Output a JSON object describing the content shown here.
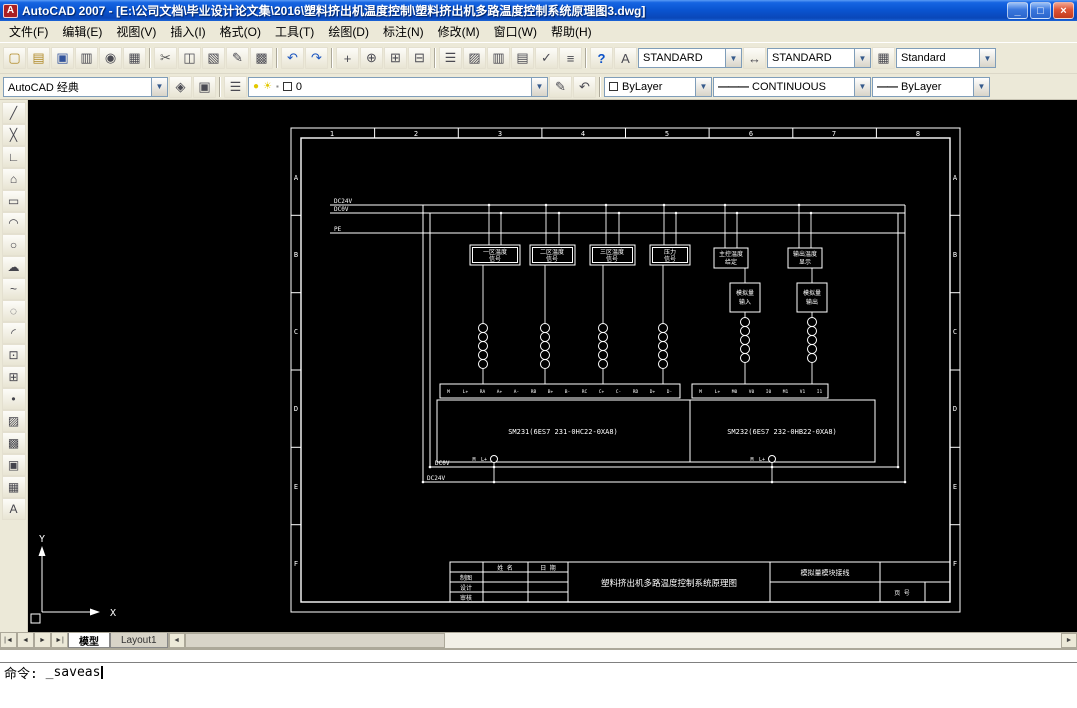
{
  "window": {
    "title": "AutoCAD 2007 - [E:\\公司文档\\毕业设计论文集\\2016\\塑料挤出机温度控制\\塑料挤出机多路温度控制系统原理图3.dwg]",
    "app_initial": "A",
    "minimize": "_",
    "maximize": "□",
    "close": "×"
  },
  "menu": {
    "items": [
      {
        "name": "menu-file",
        "label": "文件(F)"
      },
      {
        "name": "menu-edit",
        "label": "编辑(E)"
      },
      {
        "name": "menu-view",
        "label": "视图(V)"
      },
      {
        "name": "menu-insert",
        "label": "插入(I)"
      },
      {
        "name": "menu-format",
        "label": "格式(O)"
      },
      {
        "name": "menu-tools",
        "label": "工具(T)"
      },
      {
        "name": "menu-draw",
        "label": "绘图(D)"
      },
      {
        "name": "menu-dimension",
        "label": "标注(N)"
      },
      {
        "name": "menu-modify",
        "label": "修改(M)"
      },
      {
        "name": "menu-window",
        "label": "窗口(W)"
      },
      {
        "name": "menu-help",
        "label": "帮助(H)"
      }
    ]
  },
  "toolbar1": {
    "icons": [
      {
        "name": "new-button",
        "glyph": "▢"
      },
      {
        "name": "open-button",
        "glyph": "▤"
      },
      {
        "name": "save-button",
        "glyph": "▣"
      },
      {
        "name": "plot-button",
        "glyph": "▥"
      },
      {
        "name": "plot-preview-button",
        "glyph": "◉"
      },
      {
        "name": "publish-button",
        "glyph": "▦"
      },
      {
        "name": "separator"
      },
      {
        "name": "cut-button",
        "glyph": "✂"
      },
      {
        "name": "copy-button",
        "glyph": "◫"
      },
      {
        "name": "paste-button",
        "glyph": "▧"
      },
      {
        "name": "match-properties-button",
        "glyph": "✎"
      },
      {
        "name": "block-editor-button",
        "glyph": "▩"
      },
      {
        "name": "separator"
      },
      {
        "name": "undo-button",
        "glyph": "↶"
      },
      {
        "name": "redo-button",
        "glyph": "↷"
      },
      {
        "name": "separator"
      },
      {
        "name": "pan-button",
        "glyph": "+"
      },
      {
        "name": "zoom-realtime-button",
        "glyph": "⊕"
      },
      {
        "name": "zoom-window-button",
        "glyph": "⊞"
      },
      {
        "name": "zoom-previous-button",
        "glyph": "⊟"
      },
      {
        "name": "separator"
      },
      {
        "name": "properties-button",
        "glyph": "☰"
      },
      {
        "name": "designcenter-button",
        "glyph": "▨"
      },
      {
        "name": "tool-palettes-button",
        "glyph": "▥"
      },
      {
        "name": "sheetset-manager-button",
        "glyph": "▤"
      },
      {
        "name": "markup-button",
        "glyph": "✓"
      },
      {
        "name": "quickcalc-button",
        "glyph": "≡"
      },
      {
        "name": "separator"
      },
      {
        "name": "help-button",
        "glyph": "?"
      }
    ],
    "text_style_icon": "A",
    "dim_style_icon": "↔",
    "table_style_icon": "▦",
    "text_style": "STANDARD",
    "dim_style": "STANDARD",
    "table_style": "Standard",
    "dropdown_arrow": "▼"
  },
  "toolbar2": {
    "workspace_value": "AutoCAD 经典",
    "workspace_icons": [
      {
        "name": "workspace-settings-button",
        "glyph": "◈"
      },
      {
        "name": "save-workspace-button",
        "glyph": "▣"
      }
    ],
    "layer_left_icons": [
      {
        "name": "layer-properties-button",
        "glyph": "☰"
      }
    ],
    "layer_combo_icons": [
      {
        "name": "layer-on-icon",
        "glyph": "●"
      },
      {
        "name": "layer-freeze-icon",
        "glyph": "☀"
      },
      {
        "name": "layer-lock-icon",
        "glyph": "▪"
      }
    ],
    "layer_value": "0",
    "layer_right_icons": [
      {
        "name": "make-layer-current-button",
        "glyph": "✎"
      },
      {
        "name": "layer-previous-button",
        "glyph": "↶"
      }
    ],
    "color_value": "ByLayer",
    "linetype_glyph": "———",
    "linetype_value": "CONTINUOUS",
    "lineweight_glyph": "——",
    "lineweight_value": "ByLayer"
  },
  "draw_toolbar": {
    "icons": [
      {
        "name": "line-button",
        "glyph": "╱"
      },
      {
        "name": "construction-line-button",
        "glyph": "╳"
      },
      {
        "name": "polyline-button",
        "glyph": "∟"
      },
      {
        "name": "polygon-button",
        "glyph": "⌂"
      },
      {
        "name": "rectangle-button",
        "glyph": "▭"
      },
      {
        "name": "arc-button",
        "glyph": "◠"
      },
      {
        "name": "circle-button",
        "glyph": "○"
      },
      {
        "name": "revcloud-button",
        "glyph": "☁"
      },
      {
        "name": "spline-button",
        "glyph": "~"
      },
      {
        "name": "ellipse-button",
        "glyph": "◌"
      },
      {
        "name": "ellipse-arc-button",
        "glyph": "◜"
      },
      {
        "name": "insert-block-button",
        "glyph": "⊡"
      },
      {
        "name": "make-block-button",
        "glyph": "⊞"
      },
      {
        "name": "point-button",
        "glyph": "•"
      },
      {
        "name": "hatch-button",
        "glyph": "▨"
      },
      {
        "name": "gradient-button",
        "glyph": "▩"
      },
      {
        "name": "region-button",
        "glyph": "▣"
      },
      {
        "name": "table-button",
        "glyph": "▦"
      },
      {
        "name": "mtext-button",
        "glyph": "A"
      }
    ]
  },
  "drawing": {
    "border": {
      "cols": [
        "1",
        "2",
        "3",
        "4",
        "5",
        "6",
        "7",
        "8"
      ],
      "rows": [
        "A",
        "B",
        "C",
        "D",
        "E",
        "F"
      ]
    },
    "power_top": [
      "DC24V",
      "DC0V",
      "PE"
    ],
    "power_bottom": [
      "DC0V",
      "DC24V"
    ],
    "sensors": [
      {
        "line1": "一区温度",
        "line2": "信号"
      },
      {
        "line1": "二区温度",
        "line2": "信号"
      },
      {
        "line1": "三区温度",
        "line2": "信号"
      },
      {
        "line1": "压力",
        "line2": "信号"
      },
      {
        "line1": "主控温度",
        "line2": "给定"
      },
      {
        "line1": "输出温度",
        "line2": "显示"
      }
    ],
    "aux_boxes": [
      {
        "line1": "模拟量",
        "line2": "输入"
      },
      {
        "line1": "模拟量",
        "line2": "输出"
      }
    ],
    "plc": {
      "left_label": "SM231(6ES7 231-0HC22-0XA8)",
      "right_label": "SM232(6ES7 232-0HB22-0XA8)",
      "left_terminals": [
        "M",
        "L+",
        "RA",
        "A+",
        "A-",
        "RB",
        "B+",
        "B-",
        "RC",
        "C+",
        "C-",
        "RD",
        "D+",
        "D-"
      ],
      "right_terminals": [
        "M",
        "L+",
        "M0",
        "V0",
        "I0",
        "M1",
        "V1",
        "I1"
      ],
      "gnd_labels": [
        "M",
        "L+",
        "M",
        "L+"
      ]
    },
    "titleblock": {
      "header_name": "姓 名",
      "header_date": "日 期",
      "row1": "制图",
      "row2": "设计",
      "row3": "审核",
      "title": "塑料挤出机多路温度控制系统原理图",
      "subtitle": "模拟量模块接线",
      "page": "页 号"
    },
    "ucs": {
      "x": "X",
      "y": "Y"
    }
  },
  "tabs": {
    "nav": [
      {
        "name": "first-layout-button",
        "glyph": "|◄"
      },
      {
        "name": "prev-layout-button",
        "glyph": "◄"
      },
      {
        "name": "next-layout-button",
        "glyph": "►"
      },
      {
        "name": "last-layout-button",
        "glyph": "►|"
      }
    ],
    "model": "模型",
    "layout1": "Layout1",
    "scroll_left": "◄",
    "scroll_right": "►"
  },
  "command": {
    "prompt": "命令:",
    "input": "_saveas"
  }
}
